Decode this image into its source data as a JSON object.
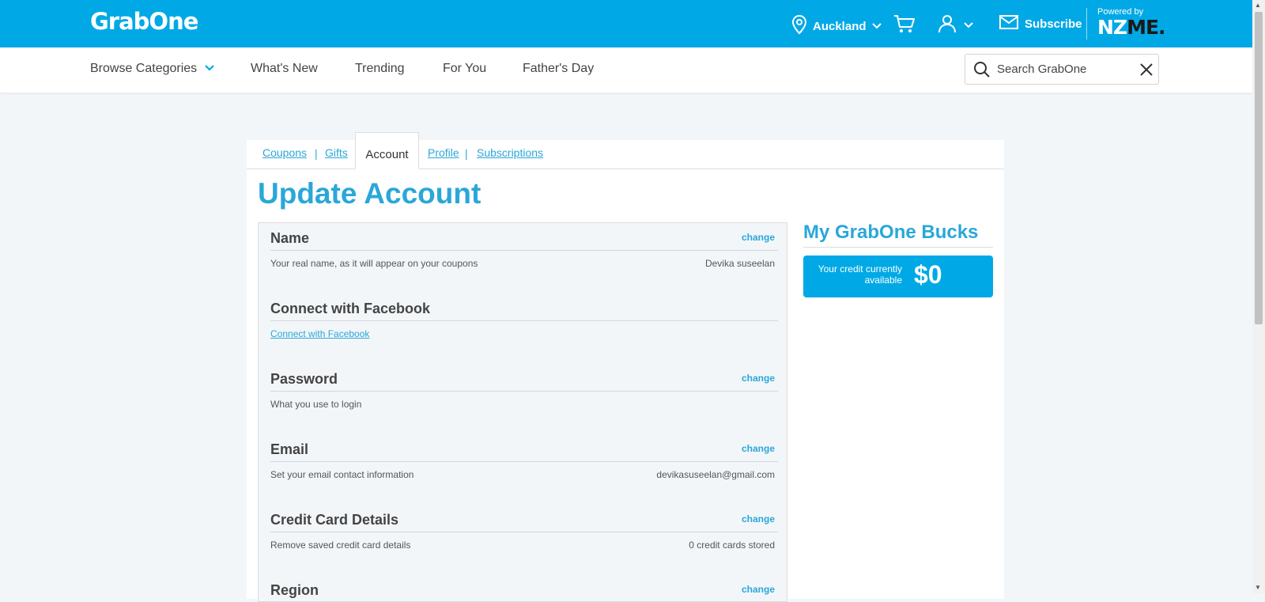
{
  "header": {
    "logo": "GrabOne",
    "location": "Auckland",
    "subscribe_label": "Subscribe",
    "powered_by": "Powered by",
    "partner_logo_left": "NZ",
    "partner_logo_right": "ME."
  },
  "nav": {
    "items": [
      {
        "label": "Browse Categories"
      },
      {
        "label": "What's New"
      },
      {
        "label": "Trending"
      },
      {
        "label": "For You"
      },
      {
        "label": "Father's Day"
      }
    ],
    "search_placeholder": "Search GrabOne"
  },
  "tabs": {
    "coupons": "Coupons",
    "gifts": "Gifts",
    "account": "Account",
    "profile": "Profile",
    "subscriptions": "Subscriptions"
  },
  "page_title": "Update Account",
  "sections": {
    "name": {
      "title": "Name",
      "change": "change",
      "desc": "Your real name, as it will appear on your coupons",
      "value": "Devika suseelan"
    },
    "facebook": {
      "title": "Connect with Facebook",
      "link": "Connect with Facebook"
    },
    "password": {
      "title": "Password",
      "change": "change",
      "desc": "What you use to login"
    },
    "email": {
      "title": "Email",
      "change": "change",
      "desc": "Set your email contact information",
      "value": "devikasuseelan@gmail.com"
    },
    "credit_card": {
      "title": "Credit Card Details",
      "change": "change",
      "desc": "Remove saved credit card details",
      "value": "0 credit cards stored"
    },
    "region": {
      "title": "Region",
      "change": "change"
    }
  },
  "bucks": {
    "title": "My GrabOne Bucks",
    "label": "Your credit currently available",
    "amount": "$0"
  },
  "colors": {
    "brand": "#00a9e6",
    "link": "#2aa7d9"
  }
}
